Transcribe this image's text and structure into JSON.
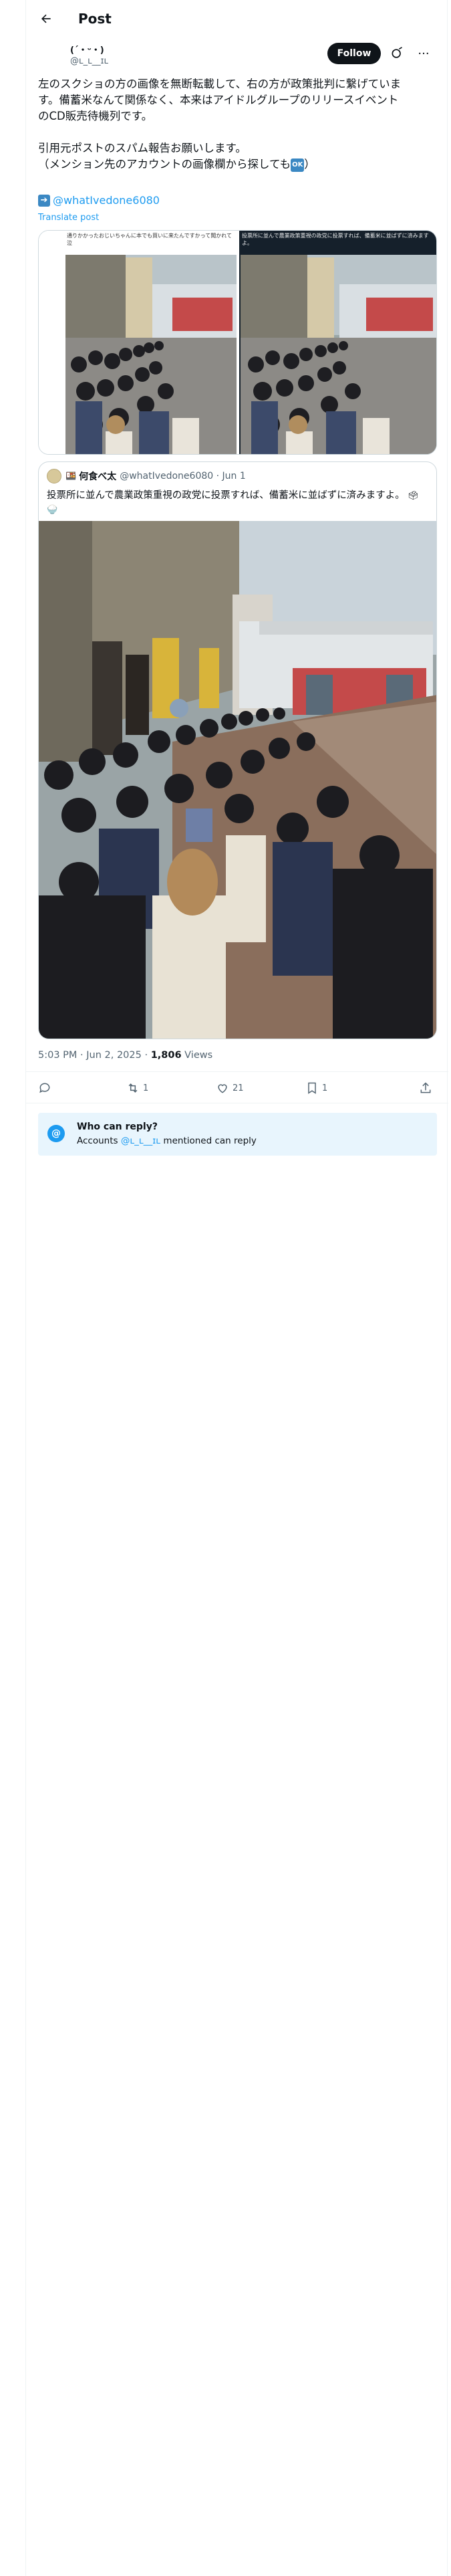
{
  "header": {
    "title": "Post"
  },
  "author": {
    "name": "(´・ᵕ・)",
    "handle": "@ʟ_ʟ__ɪʟ",
    "follow_label": "Follow"
  },
  "post": {
    "lines": [
      "左のスクショの方の画像を無断転載して、右の方が政策批判に繋げていま",
      "す。備蓄米なんて関係なく、本来はアイドルグループのリリースイベント",
      "のCD販売待機列です。",
      "",
      "引用元ポストのスパム報告お願いします。",
      "（メンション先のアカウントの画像欄から探しても"
    ],
    "ok_emoji": "OK",
    "close_paren": "）",
    "mention": "@whatIvedone6080",
    "translate": "Translate post"
  },
  "screenshots": {
    "left_caption": "通りかかったおじいちゃんに本でも買いに来たんですかって聞かれて泣",
    "right_caption": "投票所に並んで農業政策重視の政党に投票すれば、備蓄米に並ばずに済みますよ。"
  },
  "quote": {
    "name": "何食べ太",
    "handle": "@whatIvedone6080",
    "date": "Jun 1",
    "text": "投票所に並んで農業政策重視の政党に投票すれば、備蓄米に並ばずに済みますよ。"
  },
  "meta": {
    "time": "5:03 PM · Jun 2, 2025 · ",
    "views_count": "1,806",
    "views_label": " Views"
  },
  "actions": {
    "reposts": "1",
    "likes": "21",
    "bookmarks": "1"
  },
  "reply_settings": {
    "title": "Who can reply?",
    "prefix": "Accounts ",
    "mention": "@ʟ_ʟ__ɪʟ",
    "suffix": " mentioned can reply"
  },
  "colors": {
    "accent": "#1d9bf0",
    "text": "#0f1419",
    "muted": "#536471",
    "follow_bg": "#0f1419"
  }
}
